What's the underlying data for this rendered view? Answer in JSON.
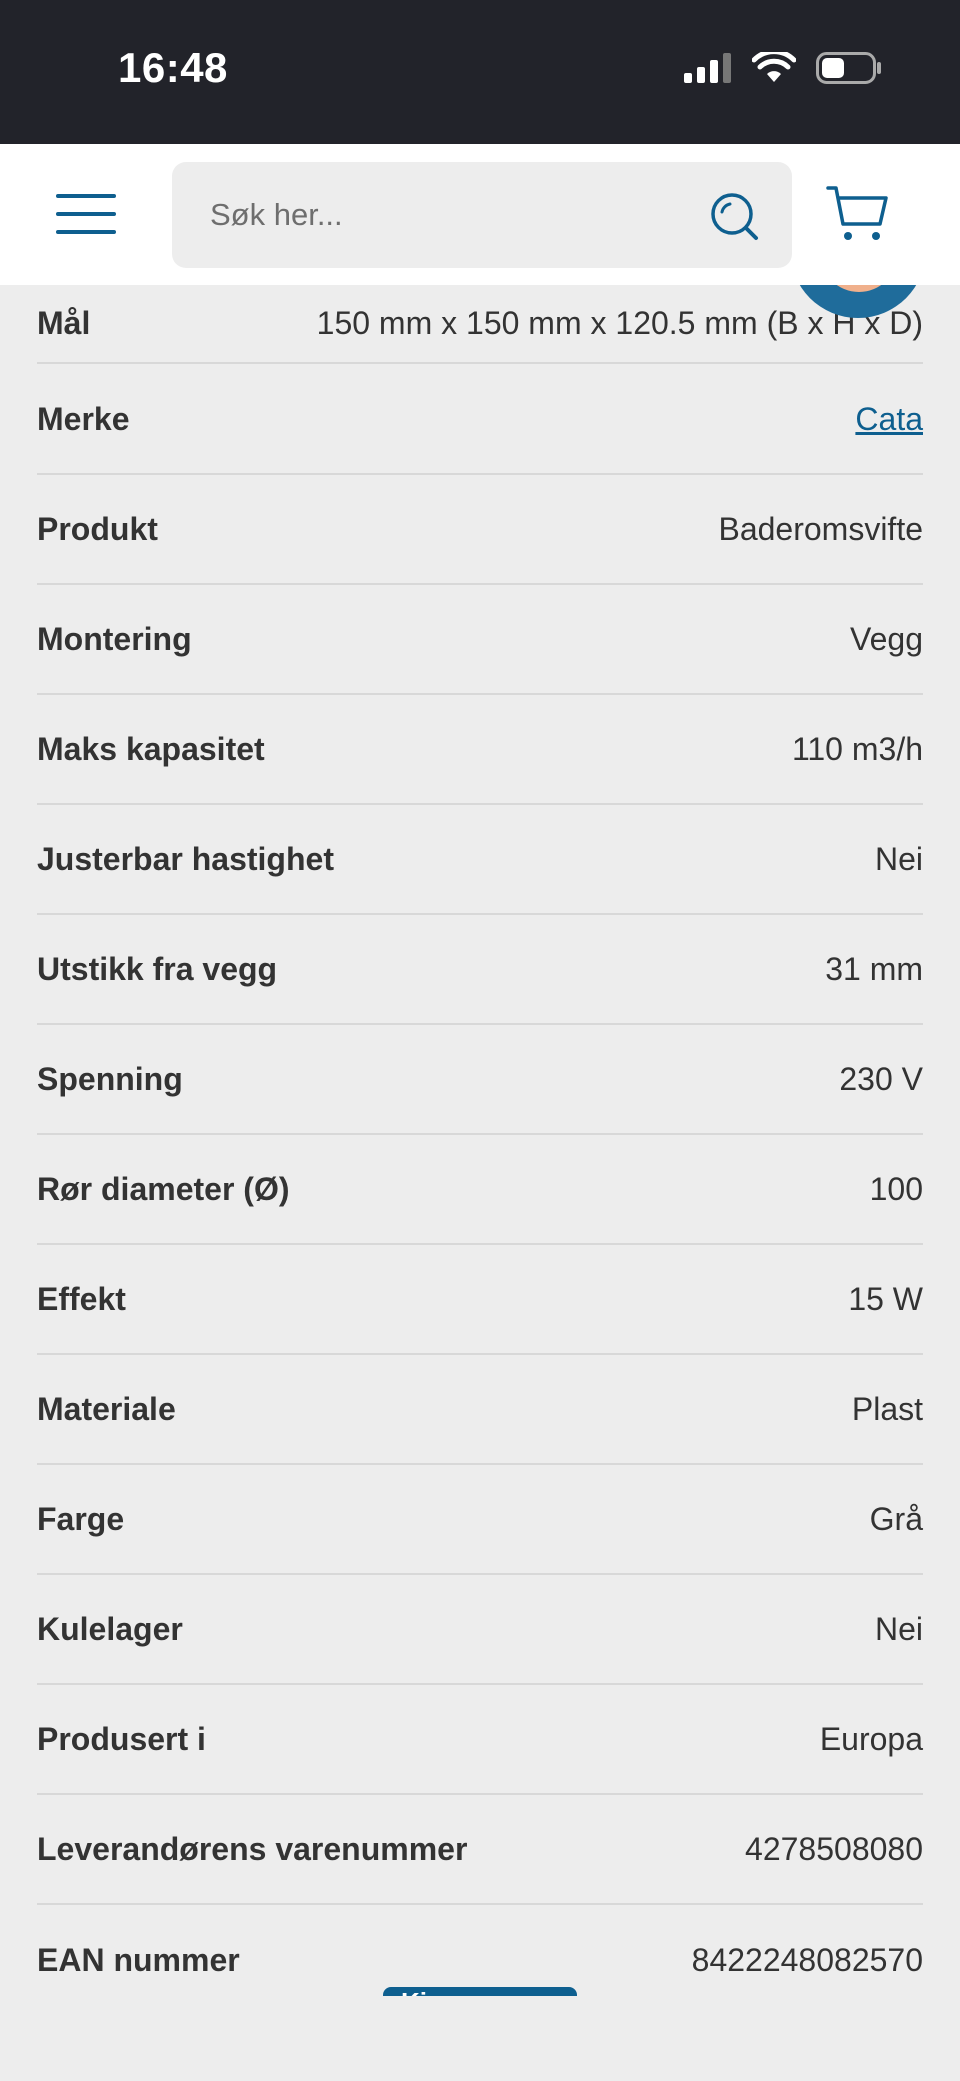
{
  "status_bar": {
    "time": "16:48"
  },
  "header": {
    "search_placeholder": "Søk her..."
  },
  "specs": [
    {
      "label": "Mål",
      "value": "150 mm x 150 mm x 120.5 mm (B x H x D)"
    },
    {
      "label": "Merke",
      "value": "Cata",
      "is_link": true
    },
    {
      "label": "Produkt",
      "value": "Baderomsvifte"
    },
    {
      "label": "Montering",
      "value": "Vegg"
    },
    {
      "label": "Maks kapasitet",
      "value": "110 m3/h"
    },
    {
      "label": "Justerbar hastighet",
      "value": "Nei"
    },
    {
      "label": "Utstikk fra vegg",
      "value": "31 mm"
    },
    {
      "label": "Spenning",
      "value": "230 V"
    },
    {
      "label": "Rør diameter (Ø)",
      "value": "100"
    },
    {
      "label": "Effekt",
      "value": "15 W"
    },
    {
      "label": "Materiale",
      "value": "Plast"
    },
    {
      "label": "Farge",
      "value": "Grå"
    },
    {
      "label": "Kulelager",
      "value": "Nei"
    },
    {
      "label": "Produsert i",
      "value": "Europa"
    },
    {
      "label": "Leverandørens varenummer",
      "value": "4278508080"
    },
    {
      "label": "EAN nummer",
      "value": "8422248082570"
    }
  ],
  "floating_button": {
    "label": "Kjøp"
  },
  "colors": {
    "accent": "#0e5f8f",
    "background": "#ededed",
    "status_bar": "#22232a"
  }
}
